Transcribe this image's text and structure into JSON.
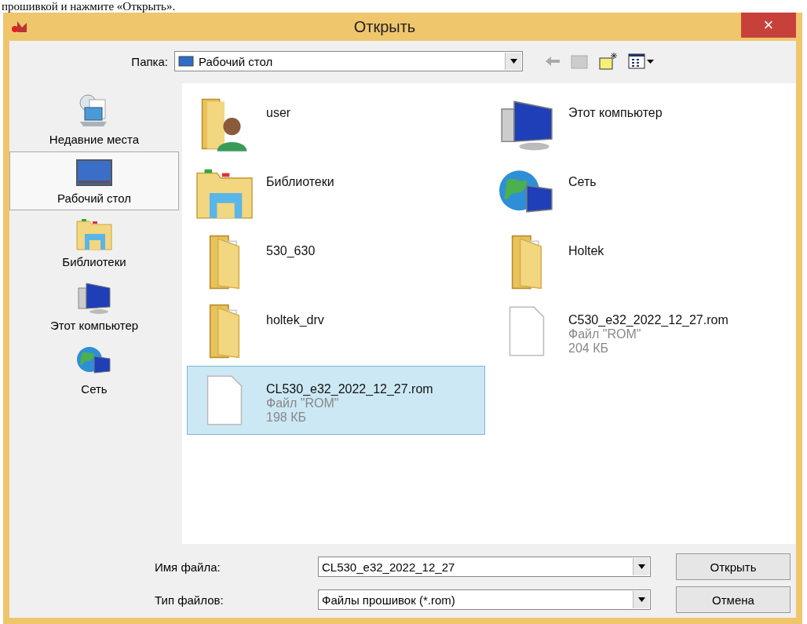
{
  "page_text": "прошивкой и нажмите «Открыть».",
  "window": {
    "title": "Открыть",
    "close": "×"
  },
  "folder_bar": {
    "label": "Папка:",
    "value": "Рабочий стол"
  },
  "places": [
    {
      "label": "Недавние места",
      "kind": "recent",
      "selected": false
    },
    {
      "label": "Рабочий стол",
      "kind": "desktop",
      "selected": true
    },
    {
      "label": "Библиотеки",
      "kind": "library",
      "selected": false
    },
    {
      "label": "Этот компьютер",
      "kind": "computer",
      "selected": false
    },
    {
      "label": "Сеть",
      "kind": "network",
      "selected": false
    }
  ],
  "files": [
    {
      "name": "user",
      "kind": "user",
      "selected": false
    },
    {
      "name": "Этот компьютер",
      "kind": "computer",
      "selected": false
    },
    {
      "name": "Библиотеки",
      "kind": "library",
      "selected": false
    },
    {
      "name": "Сеть",
      "kind": "network",
      "selected": false
    },
    {
      "name": "530_630",
      "kind": "folder",
      "selected": false
    },
    {
      "name": "Holtek",
      "kind": "folder",
      "selected": false
    },
    {
      "name": "holtek_drv",
      "kind": "folder",
      "selected": false
    },
    {
      "name": "C530_e32_2022_12_27.rom",
      "kind": "file",
      "type": "Файл \"ROM\"",
      "size": "204 КБ",
      "selected": false
    },
    {
      "name": "CL530_e32_2022_12_27.rom",
      "kind": "file",
      "type": "Файл \"ROM\"",
      "size": "198 КБ",
      "selected": true
    }
  ],
  "filename": {
    "label": "Имя файла:",
    "value": "CL530_e32_2022_12_27"
  },
  "filetype": {
    "label": "Тип файлов:",
    "value": "Файлы прошивок (*.rom)"
  },
  "buttons": [
    "Открыть",
    "Отмена"
  ]
}
